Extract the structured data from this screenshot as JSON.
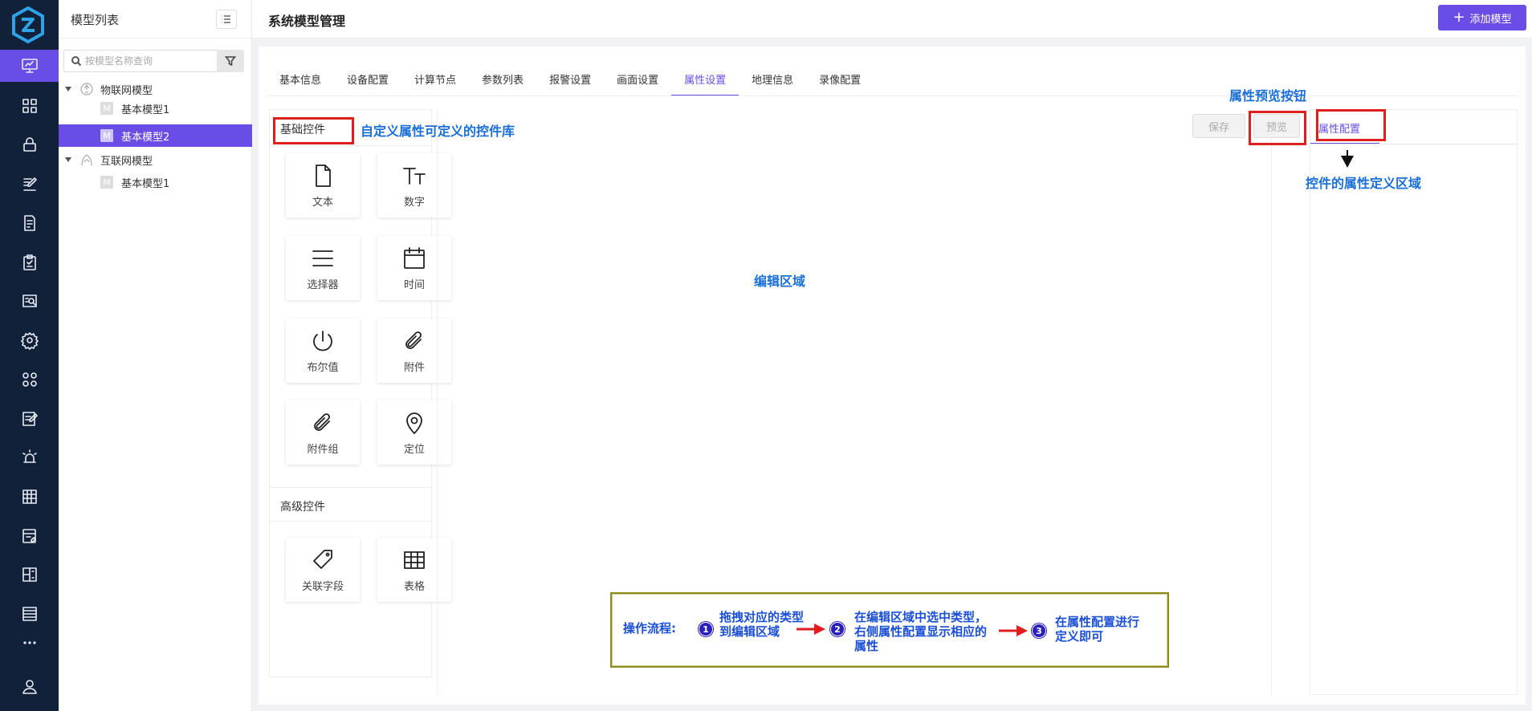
{
  "sidebar": {
    "items": [
      "monitor",
      "grid",
      "lock",
      "edit",
      "note",
      "checklist",
      "screen-search",
      "gear",
      "apps",
      "edit2",
      "alarm",
      "table-grid",
      "edit-doc",
      "dashboard",
      "list",
      "more",
      "user"
    ],
    "active_index": 0
  },
  "tree": {
    "title": "模型列表",
    "search_placeholder": "按模型名称查询",
    "nodes": [
      {
        "label": "物联网模型",
        "type": "group"
      },
      {
        "label": "基本模型1",
        "type": "model",
        "badge": "M"
      },
      {
        "label": "基本模型2",
        "type": "model",
        "badge": "M",
        "selected": true
      },
      {
        "label": "互联网模型",
        "type": "group"
      },
      {
        "label": "基本模型1",
        "type": "model",
        "badge": "M"
      }
    ]
  },
  "header": {
    "title": "系统模型管理",
    "add_button": "添加模型"
  },
  "tabs": [
    "基本信息",
    "设备配置",
    "计算节点",
    "参数列表",
    "报警设置",
    "画面设置",
    "属性设置",
    "地理信息",
    "录像配置"
  ],
  "active_tab": 6,
  "library": {
    "basic_title": "基础控件",
    "basic_controls": [
      {
        "label": "文本",
        "icon": "file-icon"
      },
      {
        "label": "数字",
        "icon": "text-size-icon"
      },
      {
        "label": "选择器",
        "icon": "menu-icon"
      },
      {
        "label": "时间",
        "icon": "calendar-icon"
      },
      {
        "label": "布尔值",
        "icon": "power-icon"
      },
      {
        "label": "附件",
        "icon": "paperclip-icon"
      },
      {
        "label": "附件组",
        "icon": "paperclip-icon"
      },
      {
        "label": "定位",
        "icon": "location-icon"
      }
    ],
    "advanced_title": "高级控件",
    "advanced_controls": [
      {
        "label": "关联字段",
        "icon": "tag-icon"
      },
      {
        "label": "表格",
        "icon": "table-icon"
      }
    ]
  },
  "toolbar": {
    "save": "保存",
    "preview": "预览"
  },
  "attr_panel": {
    "tab": "属性配置"
  },
  "annotations": {
    "library_note": "自定义属性可定义的控件库",
    "preview_note": "属性预览按钮",
    "attr_note": "控件的属性定义区域",
    "editor_note": "编辑区域",
    "flow_label": "操作流程:",
    "step1": "拖拽对应的类型到编辑区域",
    "step2": "在编辑区域中选中类型，右侧属性配置显示相应的属性",
    "step3": "在属性配置进行定义即可",
    "num1": "1",
    "num2": "2",
    "num3": "3"
  },
  "colors": {
    "accent": "#6a4ce6",
    "rail": "#12213a",
    "annotation_red": "#e01e1e",
    "annotation_blue": "#1a6fd6"
  }
}
